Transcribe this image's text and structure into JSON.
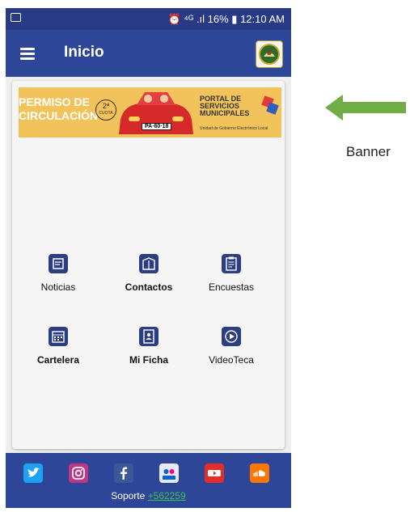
{
  "status_bar": {
    "right_text": "⏰ ⁴ᴳ .ıl 16% ▮ 12:10 AM"
  },
  "app_bar": {
    "title": "Inicio"
  },
  "banner": {
    "left_text_1": "PERMISO DE",
    "left_text_2": "CIRCULACIÓN",
    "cuota_1": "2ª",
    "cuota_2": "CUOTA",
    "plate": "PA·60·18",
    "right_text_1": "PORTAL DE",
    "right_text_2": "SERVICIOS",
    "right_text_3": "MUNICIPALES",
    "right_text_4": "Unidad de Gobierno Electrónico Local"
  },
  "menu": [
    {
      "label": "Noticias",
      "icon": "news-icon"
    },
    {
      "label": "Contactos",
      "icon": "contacts-icon"
    },
    {
      "label": "Encuestas",
      "icon": "survey-icon"
    },
    {
      "label": "Cartelera",
      "icon": "calendar-icon"
    },
    {
      "label": "Mi Ficha",
      "icon": "profile-card-icon"
    },
    {
      "label": "VideoTeca",
      "icon": "video-play-icon"
    }
  ],
  "social": [
    {
      "name": "twitter",
      "color": "#1da1f2"
    },
    {
      "name": "instagram",
      "color": "#c13584"
    },
    {
      "name": "facebook",
      "color": "#3b5998"
    },
    {
      "name": "flickr",
      "color": "#e8e8f8"
    },
    {
      "name": "youtube",
      "color": "#e52d27"
    },
    {
      "name": "soundcloud",
      "color": "#ff7700"
    }
  ],
  "support": {
    "label": "Soporte",
    "phone": "+562259"
  },
  "annotation": {
    "label": "Banner"
  },
  "colors": {
    "app_bar": "#2e4698",
    "status_bar": "#283a86",
    "arrow": "#70ad47"
  }
}
